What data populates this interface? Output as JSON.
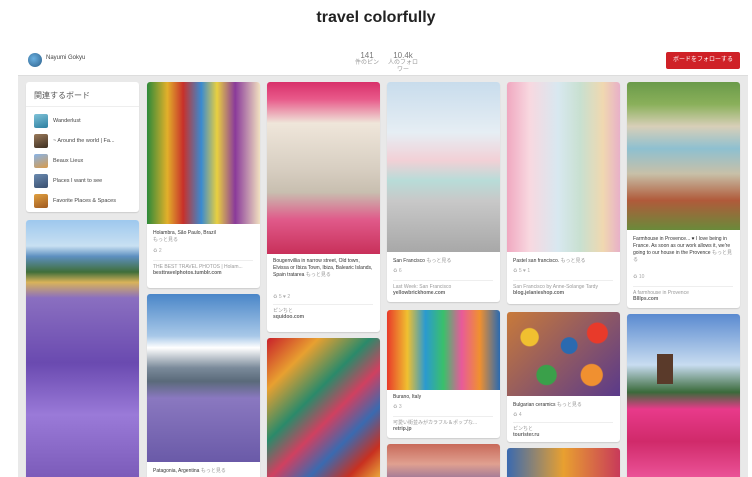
{
  "page_title": "travel colorfully",
  "header": {
    "user_name": "Nayumi Gokyu",
    "pins_count": "141",
    "pins_label": "件のピン",
    "followers_count": "10.4k",
    "followers_label": "人のフォロワー",
    "follow_button": "ボードをフォローする"
  },
  "related": {
    "title": "関連するボード",
    "items": [
      {
        "label": "Wanderlust"
      },
      {
        "label": "~ Around the world | Fa..."
      },
      {
        "label": "Beaux Lieux"
      },
      {
        "label": "Places I want to see"
      },
      {
        "label": "Favorite Places & Spaces"
      }
    ]
  },
  "pins": {
    "holambra": {
      "desc": "Holambra, São Paulo, Brazil",
      "jp": "もっと見る",
      "stats": "♻ 2",
      "source_title": "THE BEST TRAVEL PHOTOS | Holam...",
      "source_site": "besttravelphotos.tumblr.com"
    },
    "bougainvillea": {
      "desc": "Bougenvillia in narrow street, Old town, Elvissa or Ibiza Town, Ibiza, Balearic Islands, Spain tratarea",
      "jp": "もっと見る",
      "stats": "♻ 5   ♥ 2",
      "source_title": "ピンちと",
      "source_site": "squidoo.com"
    },
    "sanfrancisco": {
      "desc": "San Francisco",
      "jp": "もっと見る",
      "stats": "♻ 6",
      "source_title": "Last Week: San Francisco",
      "source_site": "yellowbrickhome.com"
    },
    "pastel": {
      "desc": "Pastel san francisco.",
      "jp": "もっと見る",
      "stats": "♻ 5   ♥ 1",
      "source_title": "San Francisco by Anne-Solange Tardy",
      "source_site": "blog.jelanieshop.com"
    },
    "farmhouse": {
      "desc": "Farmhouse in Provence... ♥ I love being in France. As soon as our work allows it, we're going to our house in the Provence",
      "jp": "もっと見る",
      "stats": "♻ 10",
      "source_title": "A farmhouse in Provence",
      "source_site": "Blllps.com"
    },
    "patagonia": {
      "desc": "Patagonia, Argentina",
      "jp": "もっと見る"
    },
    "burano": {
      "desc": "Burano, Italy",
      "stats": "♻ 3",
      "source_title": "可愛い街並みがカラフル＆ポップな...",
      "source_site": "retrip.jp"
    },
    "bulgarian": {
      "desc": "Bulgarian ceramics",
      "jp": "もっと見る",
      "stats": "♻ 4",
      "source_title": "ピンちと",
      "source_site": "tourister.ru"
    }
  },
  "colors": {
    "accent": "#cf2127",
    "board_bg": "#e9e9e9"
  }
}
